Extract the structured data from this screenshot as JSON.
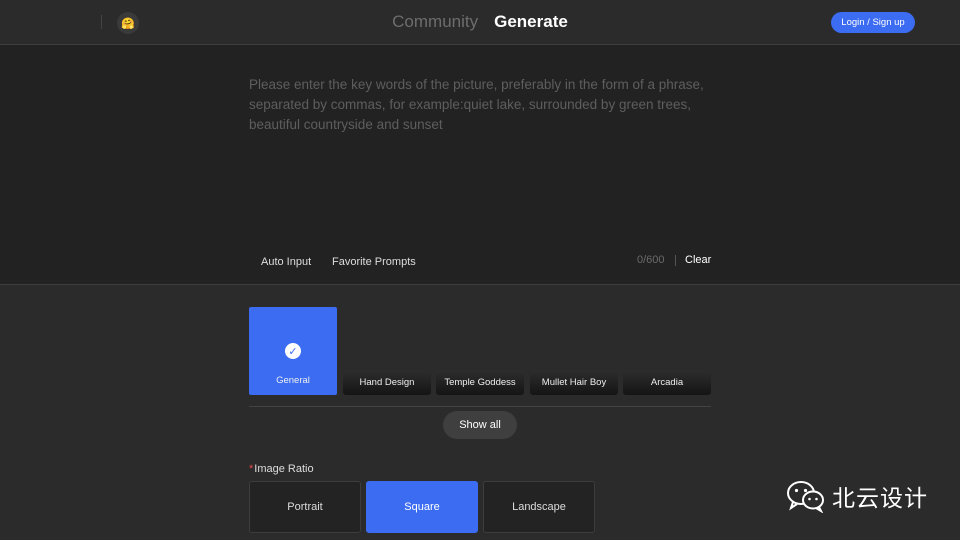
{
  "header": {
    "avatar_emoji": "🤗",
    "tabs": [
      {
        "label": "Community",
        "active": false
      },
      {
        "label": "Generate",
        "active": true
      }
    ],
    "login_label": "Login / Sign up"
  },
  "prompt": {
    "value": "",
    "placeholder": "Please enter the key words of the picture, preferably in the form of a phrase, separated by commas, for example:quiet lake, surrounded by green trees, beautiful countryside and sunset",
    "auto_input_label": "Auto Input",
    "favorite_prompts_label": "Favorite Prompts",
    "counter": "0/600",
    "clear_label": "Clear"
  },
  "styles": {
    "items": [
      {
        "label": "General",
        "selected": true
      },
      {
        "label": "Hand Design",
        "selected": false
      },
      {
        "label": "Temple Goddess",
        "selected": false
      },
      {
        "label": "Mullet Hair Boy",
        "selected": false
      },
      {
        "label": "Arcadia",
        "selected": false
      }
    ],
    "show_all_label": "Show all"
  },
  "image_ratio": {
    "required_mark": "*",
    "label": "Image Ratio",
    "options": [
      {
        "label": "Portrait",
        "selected": false
      },
      {
        "label": "Square",
        "selected": true
      },
      {
        "label": "Landscape",
        "selected": false
      }
    ]
  },
  "watermark": {
    "text": "北云设计",
    "icon": "wechat-icon"
  },
  "colors": {
    "accent": "#3b6cf2",
    "background": "#2b2b2b",
    "panel": "#222222",
    "required": "#e54545"
  }
}
